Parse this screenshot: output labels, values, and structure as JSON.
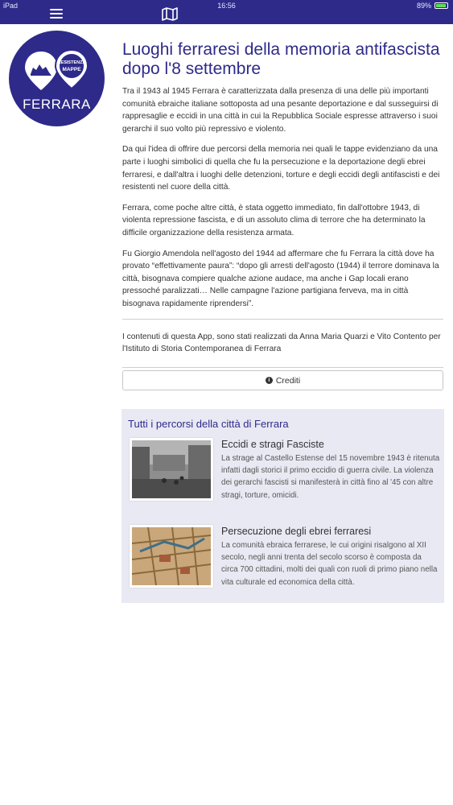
{
  "status_bar": {
    "device": "iPad",
    "time": "16:56",
    "battery": "89%"
  },
  "nav": {
    "menu_icon": "hamburger-menu-icon",
    "map_icon": "map-icon"
  },
  "logo": {
    "badge_line1": "RESISTENZA",
    "badge_line2": "MAPPE",
    "city": "FERRARA"
  },
  "colors": {
    "brand": "#2e2a8a",
    "panel": "#e9e9f4"
  },
  "main": {
    "title": "Luoghi ferraresi della memoria antifascista dopo l'8 settembre",
    "paragraphs": [
      "Tra il 1943 al 1945 Ferrara è caratterizzata dalla presenza di una delle più importanti comunità ebraiche italiane sottoposta ad una pesante deportazione e dal susseguirsi di rappresaglie e eccidi in una città in cui la Repubblica Sociale espresse attraverso i suoi gerarchi il suo volto più repressivo e violento.",
      "Da qui l'idea di offrire due percorsi della memoria nei quali le tappe evidenziano da una parte i luoghi simbolici di quella che fu la persecuzione e la deportazione degli ebrei ferraresi, e dall'altra i luoghi delle detenzioni, torture e degli eccidi degli antifascisti e dei resistenti nel cuore della città.",
      "Ferrara, come poche altre città, è stata oggetto immediato, fin dall'ottobre 1943, di violenta repressione fascista, e di un assoluto clima di terrore che ha determinato la difficile organizzazione della resistenza armata.",
      "Fu Giorgio Amendola nell'agosto del 1944 ad affermare che fu Ferrara la città dove ha provato “effettivamente paura”: “dopo gli arresti dell'agosto (1944) il terrore dominava la città, bisognava compiere qualche azione audace, ma anche i Gap locali erano pressoché paralizzati… Nelle campagne l'azione partigiana ferveva, ma in città bisognava rapidamente riprendersi”."
    ],
    "credits_note": "I contenuti di questa App, sono stati realizzati da Anna Maria Quarzi e Vito Contento per l'Istituto di Storia Contemporanea di Ferrara",
    "credits_button": "Crediti",
    "credits_icon": "info-icon"
  },
  "routes": {
    "heading": "Tutti i percorsi della città di Ferrara",
    "items": [
      {
        "title": "Eccidi e stragi Fasciste",
        "description": "La strage al Castello Estense del 15 novembre 1943 è ritenuta infatti dagli storici il primo eccidio di guerra civile. La violenza dei gerarchi fascisti si manifesterà in città fino al '45 con altre stragi, torture, omicidi."
      },
      {
        "title": "Persecuzione degli ebrei ferraresi",
        "description": "La comunità ebraica ferrarese, le cui origini risalgono al XII secolo, negli anni trenta del  secolo scorso  è  composta da circa 700 cittadini, molti dei quali con ruoli di primo piano nella vita culturale ed economica della città."
      }
    ]
  }
}
